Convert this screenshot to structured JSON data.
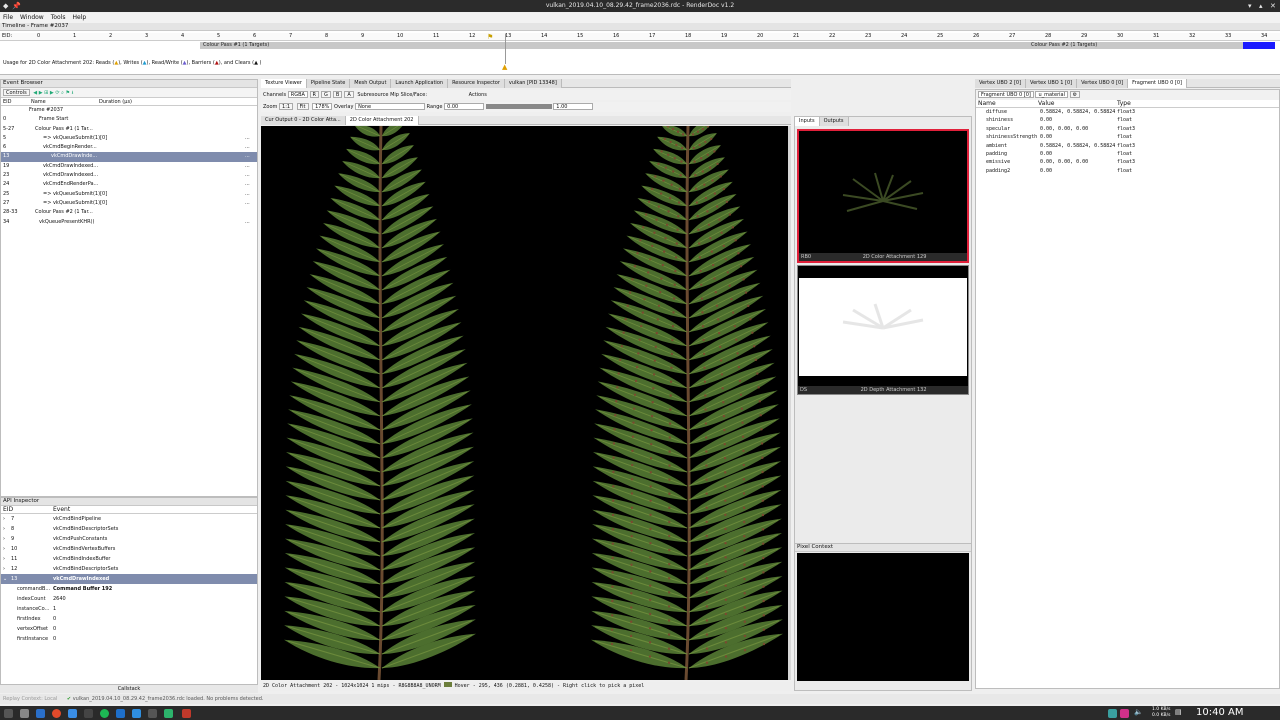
{
  "window": {
    "title": "vulkan_2019.04.10_08.29.42_frame2036.rdc - RenderDoc v1.2"
  },
  "menu": [
    "File",
    "Window",
    "Tools",
    "Help"
  ],
  "timeline": {
    "title": "Timeline - Frame #2037",
    "eid_label": "EID:",
    "ticks": [
      "0",
      "1",
      "2",
      "3",
      "4",
      "5",
      "6",
      "7",
      "8",
      "9",
      "10",
      "11",
      "12",
      "13",
      "14",
      "15",
      "16",
      "17",
      "18",
      "19",
      "20",
      "21",
      "22",
      "23",
      "24",
      "25",
      "26",
      "27",
      "28",
      "29",
      "30",
      "31",
      "32",
      "33",
      "34"
    ],
    "pass1": "Colour Pass #1 (1 Targets)",
    "pass2": "Colour Pass #2 (1 Targets)",
    "usage": "Usage for 2D Color Attachment 202: Reads (",
    "usage_writes": "), Writes (",
    "usage_rw": "), Read/Write (",
    "usage_barriers": "), Barriers (",
    "usage_clears": "), and Clears ("
  },
  "event_browser": {
    "title": "Event Browser",
    "controls": "Controls",
    "col_eid": "EID",
    "col_name": "Name",
    "col_duration": "Duration (µs)",
    "rows": [
      {
        "eid": "",
        "name": "Frame #2037",
        "dur": ""
      },
      {
        "eid": "0",
        "name": "Frame Start",
        "dur": ""
      },
      {
        "eid": "5-27",
        "name": "Colour Pass #1 (1 Tar...",
        "dur": ""
      },
      {
        "eid": "5",
        "name": "=> vkQueueSubmit(1)[0]",
        "dur": "..."
      },
      {
        "eid": "6",
        "name": "vkCmdBeginRender...",
        "dur": "..."
      },
      {
        "eid": "13",
        "name": "vkCmdDrawInde...",
        "dur": "..."
      },
      {
        "eid": "19",
        "name": "vkCmdDrawIndexed...",
        "dur": "..."
      },
      {
        "eid": "23",
        "name": "vkCmdDrawIndexed...",
        "dur": "..."
      },
      {
        "eid": "24",
        "name": "vkCmdEndRenderPa...",
        "dur": "..."
      },
      {
        "eid": "25",
        "name": "=> vkQueueSubmit(1)[0]",
        "dur": "..."
      },
      {
        "eid": "27",
        "name": "=> vkQueueSubmit(1)[0]",
        "dur": "..."
      },
      {
        "eid": "28-33",
        "name": "Colour Pass #2 (1 Tar...",
        "dur": ""
      },
      {
        "eid": "34",
        "name": "vkQueuePresentKHR()",
        "dur": "..."
      }
    ]
  },
  "api_inspector": {
    "title": "API Inspector",
    "col_eid": "EID",
    "col_event": "Event",
    "rows": [
      {
        "eid": "7",
        "event": "vkCmdBindPipeline"
      },
      {
        "eid": "8",
        "event": "vkCmdBindDescriptorSets"
      },
      {
        "eid": "9",
        "event": "vkCmdPushConstants"
      },
      {
        "eid": "10",
        "event": "vkCmdBindVertexBuffers"
      },
      {
        "eid": "11",
        "event": "vkCmdBindIndexBuffer"
      },
      {
        "eid": "12",
        "event": "vkCmdBindDescriptorSets"
      },
      {
        "eid": "13",
        "event": "vkCmdDrawIndexed"
      }
    ],
    "params": [
      {
        "k": "commandB...",
        "v": "Command Buffer 192"
      },
      {
        "k": "indexCount",
        "v": "2640"
      },
      {
        "k": "instanceCo...",
        "v": "1"
      },
      {
        "k": "firstIndex",
        "v": "0"
      },
      {
        "k": "vertexOffset",
        "v": "0"
      },
      {
        "k": "firstInstance",
        "v": "0"
      }
    ],
    "callstack": "Callstack"
  },
  "texviewer": {
    "tabs": [
      "Texture Viewer",
      "Pipeline State",
      "Mesh Output",
      "Launch Application",
      "Resource Inspector",
      "vulkan [PID 13348]"
    ],
    "channels": "Channels",
    "rgba": "RGBA",
    "ch": [
      "R",
      "G",
      "B",
      "A"
    ],
    "subresource": "Subresource",
    "mip": "Mip",
    "slice": "Slice/Face:",
    "actions": "Actions",
    "zoom": "Zoom",
    "fit": "Fit",
    "zoomval": "178%",
    "overlay": "Overlay",
    "overlay_val": "None",
    "range": "Range",
    "range_min": "0.00",
    "range_max": "1.00",
    "subtabs": [
      "Cur Output 0 - 2D Color Atta...",
      "2D Color Attachment 202"
    ],
    "status": "2D Color Attachment 202 - 1024x1024 1 mips - R8G8B8A8_UNORM",
    "status2": "Hover -  295,  436 (0.2881, 0.4258) - Right click to pick a pixel"
  },
  "thumbs": {
    "tabs": [
      "Inputs",
      "Outputs"
    ],
    "t1_left": "RB0",
    "t1_label": "2D Color Attachment 129",
    "t2_left": "DS",
    "t2_label": "2D Depth Attachment 132",
    "pixel_context": "Pixel Context"
  },
  "buffers": {
    "tabs": [
      "Vertex UBO 2 [0]",
      "Vertex UBO 1 [0]",
      "Vertex UBO 0 [0]",
      "Fragment UBO 0 [0]"
    ],
    "subtab": "Fragment UBO 0 [0]",
    "field": "u_material",
    "cols": [
      "Name",
      "Value",
      "Type"
    ],
    "rows": [
      {
        "n": "diffuse",
        "v": "0.58824, 0.58824, 0.58824",
        "t": "float3"
      },
      {
        "n": "shininess",
        "v": "0.00",
        "t": "float"
      },
      {
        "n": "specular",
        "v": "0.00, 0.00, 0.00",
        "t": "float3"
      },
      {
        "n": "shininessStrength",
        "v": "0.00",
        "t": "float"
      },
      {
        "n": "ambient",
        "v": "0.58824, 0.58824, 0.58824",
        "t": "float3"
      },
      {
        "n": "padding",
        "v": "0.00",
        "t": "float"
      },
      {
        "n": "emissive",
        "v": "0.00, 0.00, 0.00",
        "t": "float3"
      },
      {
        "n": "padding2",
        "v": "0.00",
        "t": "float"
      }
    ]
  },
  "statusbar": {
    "replay": "Replay Context: Local",
    "msg": "vulkan_2019.04.10_08.29.42_frame2036.rdc loaded. No problems detected."
  },
  "taskbar": {
    "clock": "10:40 AM",
    "net_up": "1.0 KB/s",
    "net_down": "0.0 KB/s"
  }
}
